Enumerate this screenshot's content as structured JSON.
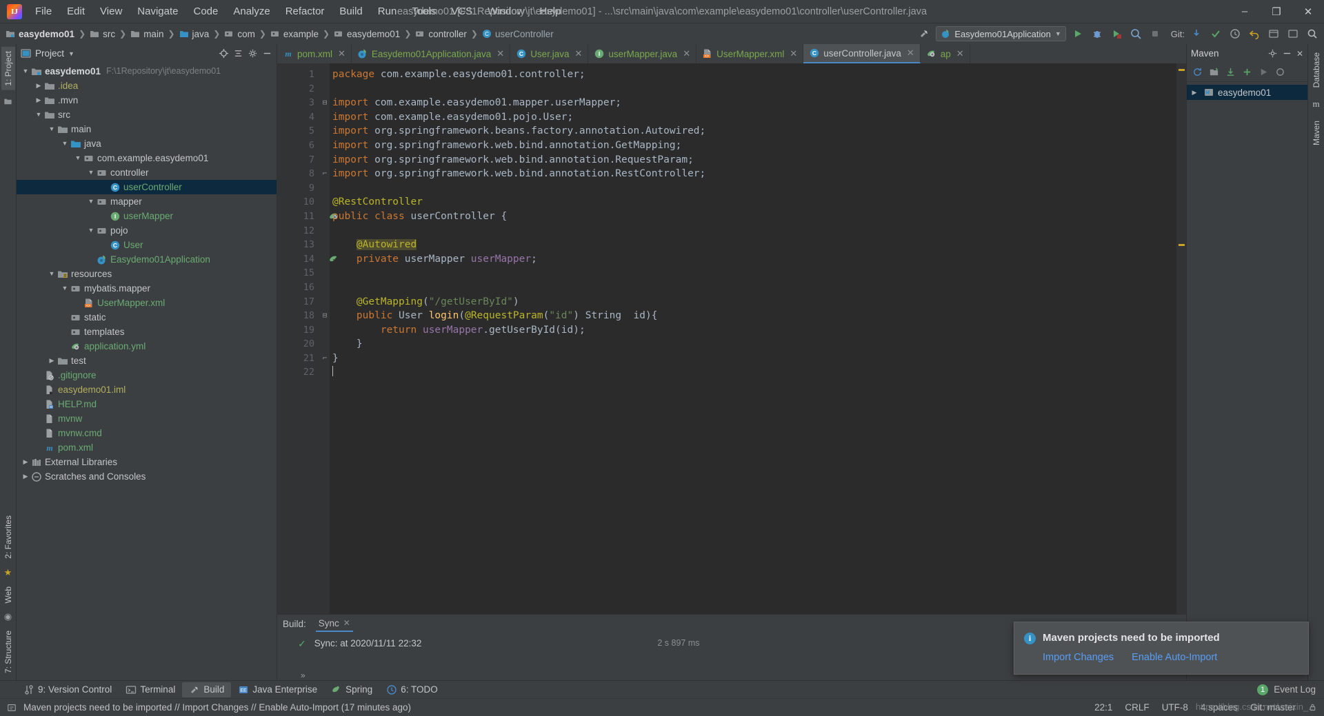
{
  "window": {
    "title": "easydemo01 [F:\\1Repository\\jt\\easydemo01] - ...\\src\\main\\java\\com\\example\\easydemo01\\controller\\userController.java",
    "minimize": "–",
    "maximize": "❐",
    "close": "✕"
  },
  "menu": [
    {
      "label": "File"
    },
    {
      "label": "Edit"
    },
    {
      "label": "View"
    },
    {
      "label": "Navigate"
    },
    {
      "label": "Code"
    },
    {
      "label": "Analyze"
    },
    {
      "label": "Refactor"
    },
    {
      "label": "Build"
    },
    {
      "label": "Run"
    },
    {
      "label": "Tools"
    },
    {
      "label": "VCS"
    },
    {
      "label": "Window"
    },
    {
      "label": "Help"
    }
  ],
  "breadcrumb": [
    {
      "label": "easydemo01",
      "icon": "module-icon",
      "style": "bold"
    },
    {
      "label": "src",
      "icon": "folder-icon",
      "style": "plain"
    },
    {
      "label": "main",
      "icon": "folder-icon",
      "style": "plain"
    },
    {
      "label": "java",
      "icon": "source-folder-icon",
      "style": "plain"
    },
    {
      "label": "com",
      "icon": "package-icon",
      "style": "plain"
    },
    {
      "label": "example",
      "icon": "package-icon",
      "style": "plain"
    },
    {
      "label": "easydemo01",
      "icon": "package-icon",
      "style": "plain"
    },
    {
      "label": "controller",
      "icon": "package-icon",
      "style": "plain"
    },
    {
      "label": "userController",
      "icon": "class-icon",
      "style": "class"
    }
  ],
  "toolbar": {
    "run_config": "Easydemo01Application",
    "git_label": "Git:",
    "search_icon": "search-icon"
  },
  "project_panel": {
    "title": "Project",
    "tree": [
      {
        "depth": 0,
        "twist": "▼",
        "icon": "module-icon",
        "label": "easydemo01",
        "style": "bold",
        "sub": "F:\\1Repository\\jt\\easydemo01"
      },
      {
        "depth": 1,
        "twist": "▶",
        "icon": "folder-icon",
        "label": ".idea",
        "style": "yellow"
      },
      {
        "depth": 1,
        "twist": "▶",
        "icon": "folder-icon",
        "label": ".mvn",
        "style": "plain"
      },
      {
        "depth": 1,
        "twist": "▼",
        "icon": "folder-icon",
        "label": "src",
        "style": "plain"
      },
      {
        "depth": 2,
        "twist": "▼",
        "icon": "folder-icon",
        "label": "main",
        "style": "plain"
      },
      {
        "depth": 3,
        "twist": "▼",
        "icon": "source-folder-icon",
        "label": "java",
        "style": "plain"
      },
      {
        "depth": 4,
        "twist": "▼",
        "icon": "package-icon",
        "label": "com.example.easydemo01",
        "style": "plain"
      },
      {
        "depth": 5,
        "twist": "▼",
        "icon": "package-icon",
        "label": "controller",
        "style": "plain"
      },
      {
        "depth": 6,
        "twist": "",
        "icon": "class-icon",
        "label": "userController",
        "style": "green",
        "selected": true
      },
      {
        "depth": 5,
        "twist": "▼",
        "icon": "package-icon",
        "label": "mapper",
        "style": "plain"
      },
      {
        "depth": 6,
        "twist": "",
        "icon": "interface-icon",
        "label": "userMapper",
        "style": "green"
      },
      {
        "depth": 5,
        "twist": "▼",
        "icon": "package-icon",
        "label": "pojo",
        "style": "plain"
      },
      {
        "depth": 6,
        "twist": "",
        "icon": "class-icon",
        "label": "User",
        "style": "green"
      },
      {
        "depth": 5,
        "twist": "",
        "icon": "spring-class-icon",
        "label": "Easydemo01Application",
        "style": "green"
      },
      {
        "depth": 2,
        "twist": "▼",
        "icon": "resource-folder-icon",
        "label": "resources",
        "style": "plain"
      },
      {
        "depth": 3,
        "twist": "▼",
        "icon": "package-icon",
        "label": "mybatis.mapper",
        "style": "plain"
      },
      {
        "depth": 4,
        "twist": "",
        "icon": "xml-file-icon",
        "label": "UserMapper.xml",
        "style": "green"
      },
      {
        "depth": 3,
        "twist": "",
        "icon": "package-icon",
        "label": "static",
        "style": "plain"
      },
      {
        "depth": 3,
        "twist": "",
        "icon": "package-icon",
        "label": "templates",
        "style": "plain"
      },
      {
        "depth": 3,
        "twist": "",
        "icon": "spring-yml-icon",
        "label": "application.yml",
        "style": "green"
      },
      {
        "depth": 2,
        "twist": "▶",
        "icon": "folder-icon",
        "label": "test",
        "style": "plain"
      },
      {
        "depth": 1,
        "twist": "",
        "icon": "gitignore-icon",
        "label": ".gitignore",
        "style": "green"
      },
      {
        "depth": 1,
        "twist": "",
        "icon": "iml-file-icon",
        "label": "easydemo01.iml",
        "style": "yellow"
      },
      {
        "depth": 1,
        "twist": "",
        "icon": "markdown-icon",
        "label": "HELP.md",
        "style": "green"
      },
      {
        "depth": 1,
        "twist": "",
        "icon": "file-icon",
        "label": "mvnw",
        "style": "green"
      },
      {
        "depth": 1,
        "twist": "",
        "icon": "file-icon",
        "label": "mvnw.cmd",
        "style": "green"
      },
      {
        "depth": 1,
        "twist": "",
        "icon": "maven-pom-icon",
        "label": "pom.xml",
        "style": "green"
      },
      {
        "depth": 0,
        "twist": "▶",
        "icon": "libraries-icon",
        "label": "External Libraries",
        "style": "plain"
      },
      {
        "depth": 0,
        "twist": "▶",
        "icon": "scratches-icon",
        "label": "Scratches and Consoles",
        "style": "plain"
      }
    ]
  },
  "left_strip": {
    "tabs": [
      {
        "label": "1: Project",
        "active": true
      },
      {
        "label": "2: Favorites"
      },
      {
        "label": "Web"
      },
      {
        "label": "7: Structure"
      }
    ]
  },
  "right_strip": {
    "tabs": [
      {
        "label": "Database"
      },
      {
        "label": "Maven"
      }
    ]
  },
  "editor": {
    "tabs": [
      {
        "label": "pom.xml",
        "icon": "maven-pom-icon",
        "active": false
      },
      {
        "label": "Easydemo01Application.java",
        "icon": "spring-class-icon",
        "active": false
      },
      {
        "label": "User.java",
        "icon": "class-icon",
        "active": false
      },
      {
        "label": "userMapper.java",
        "icon": "interface-icon",
        "active": false
      },
      {
        "label": "UserMapper.xml",
        "icon": "xml-file-icon",
        "active": false
      },
      {
        "label": "userController.java",
        "icon": "class-icon",
        "active": true
      },
      {
        "label": "ap",
        "icon": "spring-yml-icon",
        "active": false
      }
    ],
    "lines": [
      {
        "n": 1,
        "fold": "",
        "gmark": "",
        "html": "<span class=\"kw\">package</span> com.example.easydemo01.controller;"
      },
      {
        "n": 2,
        "fold": "",
        "gmark": "",
        "html": ""
      },
      {
        "n": 3,
        "fold": "⊟",
        "gmark": "",
        "html": "<span class=\"kw\">import</span> com.example.easydemo01.mapper.userMapper;"
      },
      {
        "n": 4,
        "fold": "",
        "gmark": "",
        "html": "<span class=\"kw\">import</span> com.example.easydemo01.pojo.User;"
      },
      {
        "n": 5,
        "fold": "",
        "gmark": "",
        "html": "<span class=\"kw\">import</span> org.springframework.beans.factory.annotation.Autowired;"
      },
      {
        "n": 6,
        "fold": "",
        "gmark": "",
        "html": "<span class=\"kw\">import</span> org.springframework.web.bind.annotation.GetMapping;"
      },
      {
        "n": 7,
        "fold": "",
        "gmark": "",
        "html": "<span class=\"kw\">import</span> org.springframework.web.bind.annotation.RequestParam;"
      },
      {
        "n": 8,
        "fold": "⌐",
        "gmark": "",
        "html": "<span class=\"kw\">import</span> org.springframework.web.bind.annotation.RestController;"
      },
      {
        "n": 9,
        "fold": "",
        "gmark": "",
        "html": ""
      },
      {
        "n": 10,
        "fold": "",
        "gmark": "",
        "html": "<span class=\"ann\">@RestController</span>"
      },
      {
        "n": 11,
        "fold": "",
        "gmark": "spring-bean-icon",
        "html": "<span class=\"kw\">public class</span> userController {"
      },
      {
        "n": 12,
        "fold": "",
        "gmark": "",
        "html": ""
      },
      {
        "n": 13,
        "fold": "",
        "gmark": "",
        "html": "    <span class=\"hl-ann\">@Autowired</span>"
      },
      {
        "n": 14,
        "fold": "",
        "gmark": "bean-arrow-icon",
        "html": "    <span class=\"kw\">private</span> userMapper <span class=\"fld\">userMapper</span>;"
      },
      {
        "n": 15,
        "fold": "",
        "gmark": "",
        "html": ""
      },
      {
        "n": 16,
        "fold": "",
        "gmark": "",
        "html": ""
      },
      {
        "n": 17,
        "fold": "",
        "gmark": "",
        "html": "    <span class=\"ann\">@GetMapping</span>(<span class=\"str\">\"/getUserById\"</span>)"
      },
      {
        "n": 18,
        "fold": "⊟",
        "gmark": "",
        "html": "    <span class=\"kw\">public</span> User <span class=\"mth\">login</span>(<span class=\"ann\">@RequestParam</span>(<span class=\"str\">\"id\"</span>) String  id){"
      },
      {
        "n": 19,
        "fold": "",
        "gmark": "",
        "html": "        <span class=\"kw\">return</span> <span class=\"fld\">userMapper</span>.getUserById(id);"
      },
      {
        "n": 20,
        "fold": "",
        "gmark": "",
        "html": "    }"
      },
      {
        "n": 21,
        "fold": "⌐",
        "gmark": "",
        "html": "}"
      },
      {
        "n": 22,
        "fold": "",
        "gmark": "",
        "html": "<span class=\"caret\"></span>"
      }
    ]
  },
  "maven_panel": {
    "title": "Maven",
    "tree": [
      {
        "label": "easydemo01",
        "twist": "▶",
        "icon": "maven-module-icon"
      }
    ]
  },
  "build_panel": {
    "label": "Build:",
    "tab": "Sync",
    "status_text": "Sync: at 2020/11/11 22:32",
    "duration": "2 s 897 ms"
  },
  "bottom_tabs": [
    {
      "label": "9: Version Control",
      "icon": "vcs-icon",
      "active": false
    },
    {
      "label": "Terminal",
      "icon": "terminal-icon",
      "active": false
    },
    {
      "label": "Build",
      "icon": "build-icon",
      "active": true
    },
    {
      "label": "Java Enterprise",
      "icon": "java-ee-icon",
      "active": false
    },
    {
      "label": "Spring",
      "icon": "spring-icon",
      "active": false
    },
    {
      "label": "6: TODO",
      "icon": "todo-icon",
      "active": false
    }
  ],
  "event_log": {
    "count": "1",
    "label": "Event Log"
  },
  "statusbar": {
    "message": "Maven projects need to be imported // Import Changes // Enable Auto-Import (17 minutes ago)",
    "caret": "22:1",
    "line_sep": "CRLF",
    "encoding": "UTF-8",
    "indent": "4 spaces",
    "branch": "Git: master"
  },
  "notification": {
    "title": "Maven projects need to be imported",
    "links": [
      "Import Changes",
      "Enable Auto-Import"
    ]
  },
  "watermark": "https://blog.csdn.net/weixin_..."
}
